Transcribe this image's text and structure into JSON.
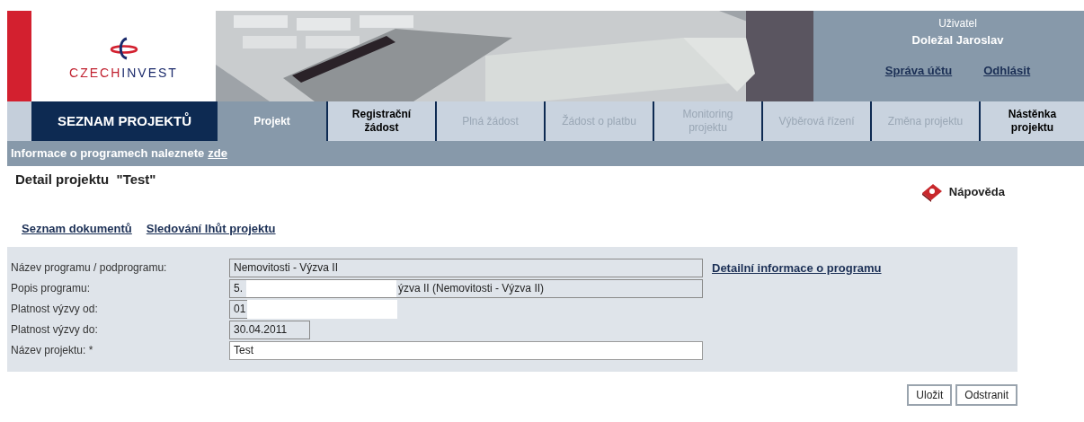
{
  "logo": {
    "text_first": "CZECH",
    "text_second": "INVEST"
  },
  "user": {
    "label": "Uživatel",
    "name": "Doležal Jaroslav",
    "links": [
      "Správa účtu",
      "Odhlásit"
    ]
  },
  "nav": {
    "home": "SEZNAM PROJEKTŮ",
    "tabs": [
      {
        "label": "Projekt",
        "selected": true,
        "disabled": false
      },
      {
        "label": "Registrační žádost",
        "selected": false,
        "disabled": false
      },
      {
        "label": "Plná žádost",
        "selected": false,
        "disabled": true
      },
      {
        "label": "Žádost o platbu",
        "selected": false,
        "disabled": true
      },
      {
        "label": "Monitoring projektu",
        "selected": false,
        "disabled": true
      },
      {
        "label": "Výběrová řízení",
        "selected": false,
        "disabled": true
      },
      {
        "label": "Změna projektu",
        "selected": false,
        "disabled": true
      },
      {
        "label": "Nástěnka projektu",
        "selected": false,
        "disabled": false
      }
    ]
  },
  "info_bar": {
    "text": "Informace o programech naleznete",
    "link": "zde"
  },
  "page_title": "Detail projektu  \"Test\"",
  "help": "Nápověda",
  "doc_links": [
    "Seznam dokumentů",
    "Sledování lhůt projektu"
  ],
  "form": {
    "fields": [
      {
        "label": "Název programu / podprogramu:",
        "value": "Nemovitosti - Výzva II",
        "kind": "text",
        "editable": false
      },
      {
        "label": "Popis programu:",
        "value": "5.",
        "value_after": "ýzva II (Nemovitosti - Výzva II)",
        "kind": "text",
        "editable": false,
        "redacted": true
      },
      {
        "label": "Platnost výzvy od:",
        "value": "01",
        "kind": "date",
        "editable": false,
        "redacted": true
      },
      {
        "label": "Platnost výzvy do:",
        "value": "30.04.2011",
        "kind": "date",
        "editable": false
      },
      {
        "label": "Název projektu: *",
        "value": "Test",
        "kind": "text",
        "editable": true
      }
    ],
    "detail_link": "Detailní informace o programu"
  },
  "buttons": [
    "Uložit",
    "Odstranit"
  ]
}
